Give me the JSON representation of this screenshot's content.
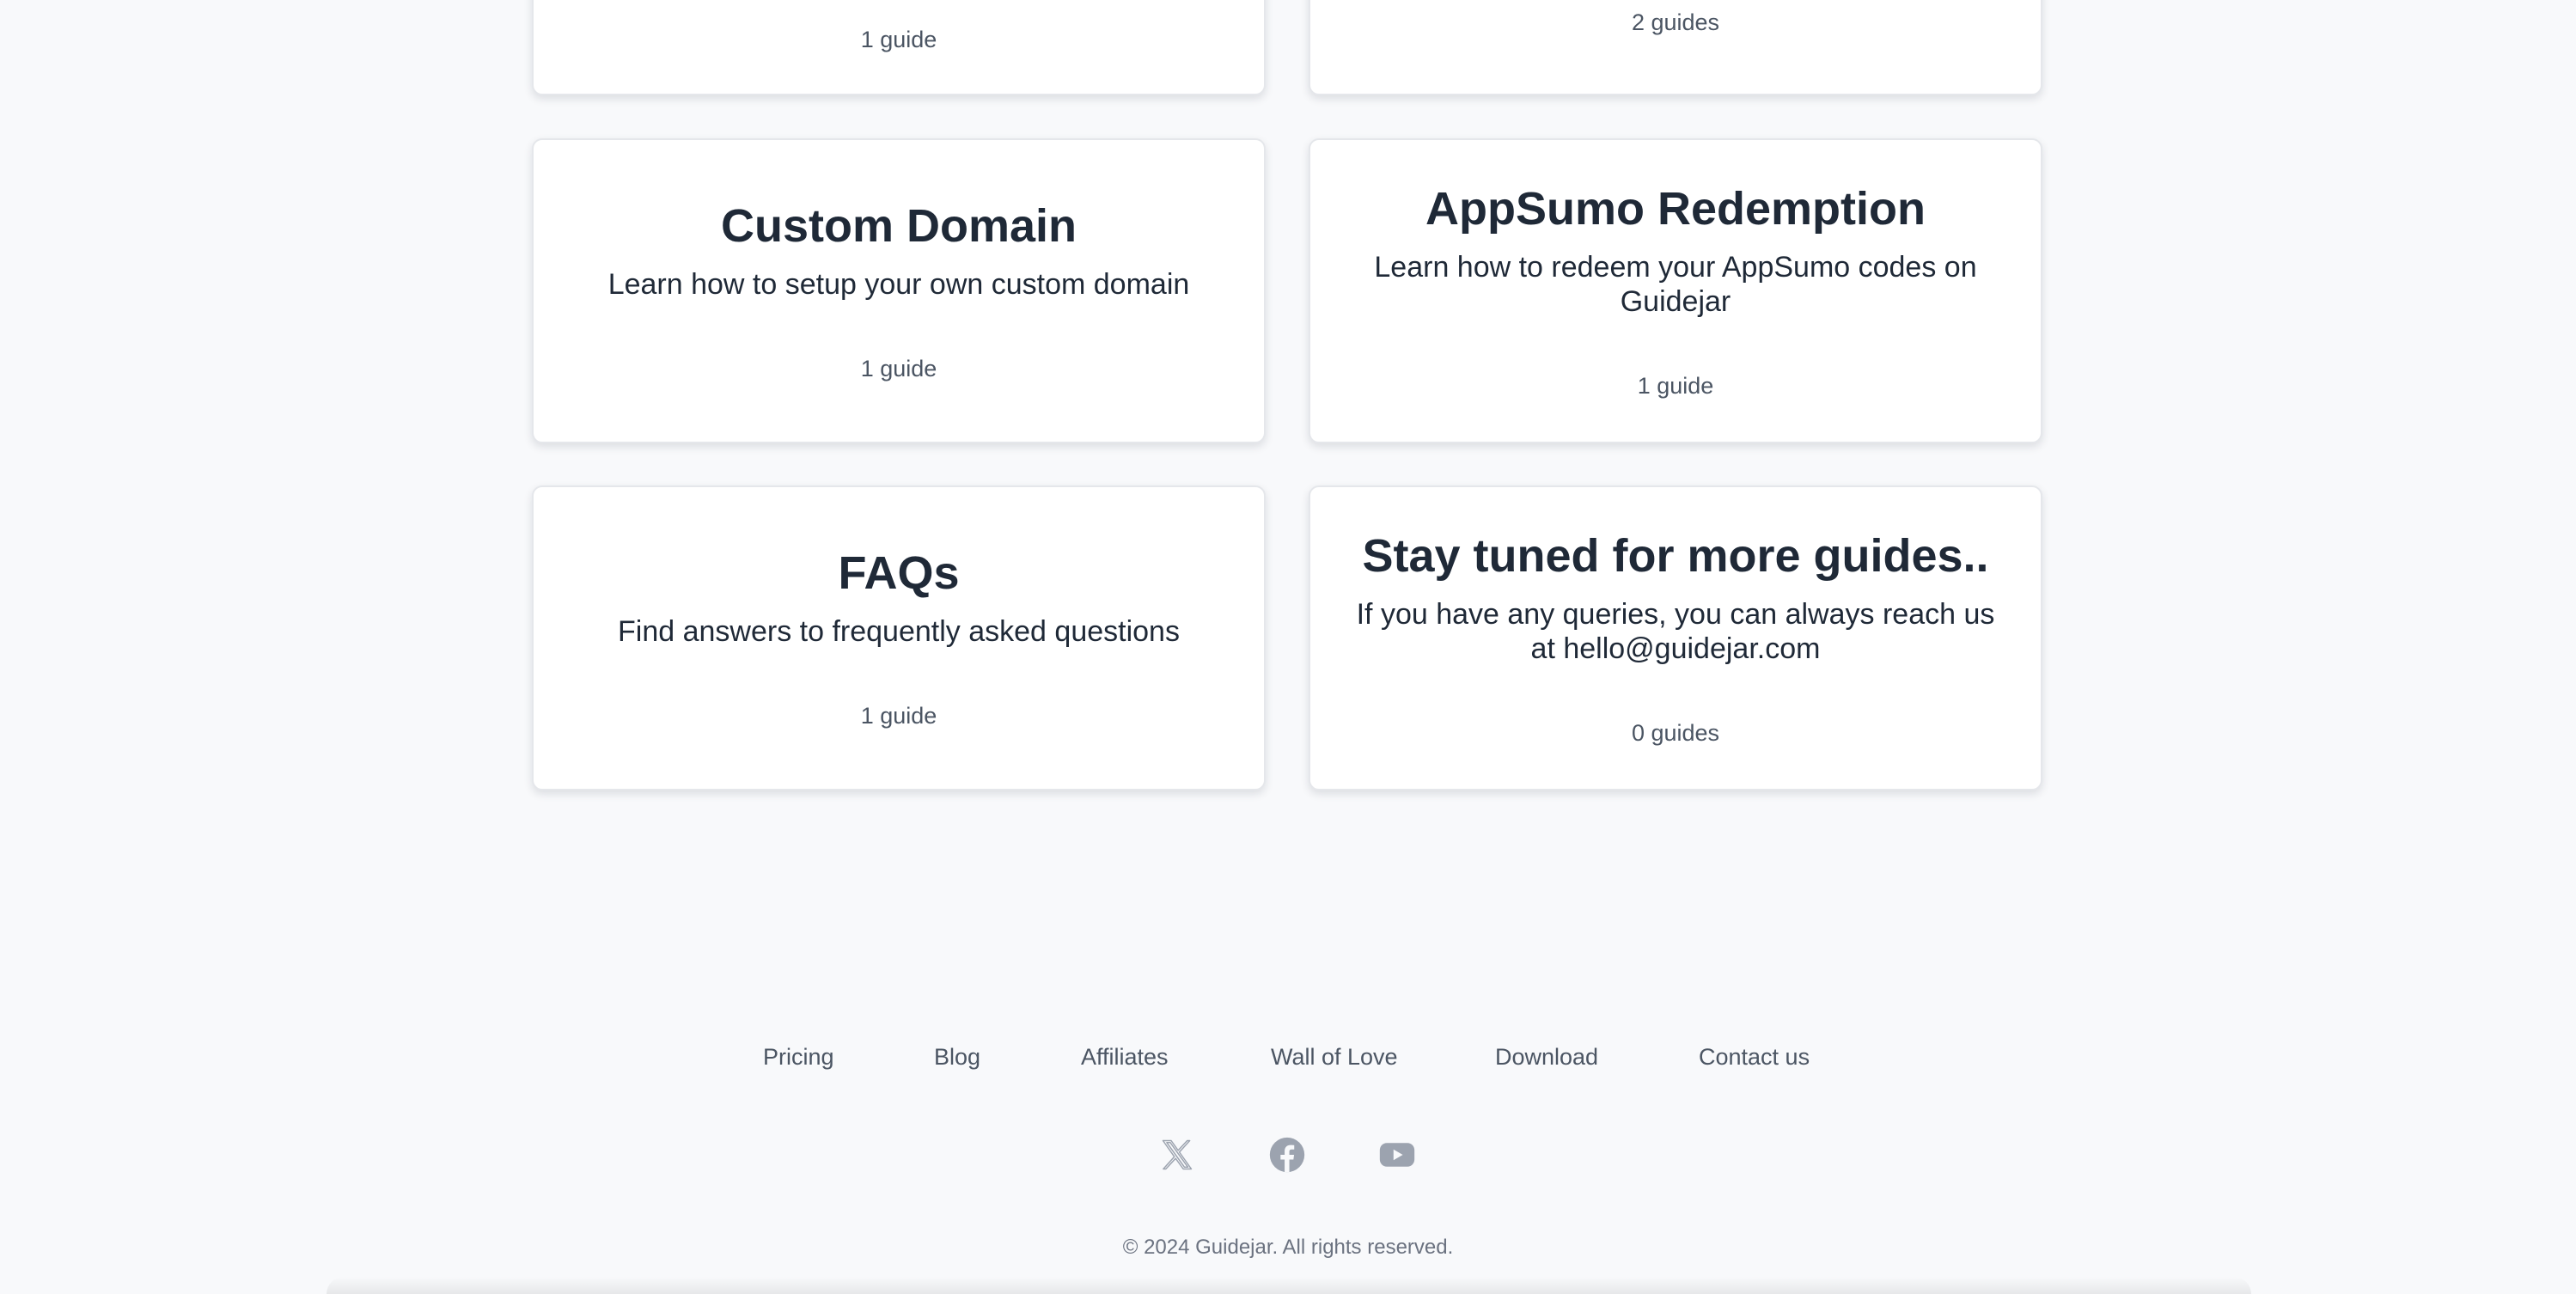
{
  "cards": [
    {
      "title": "",
      "description": "",
      "count": "1 guide"
    },
    {
      "title": "",
      "description": "",
      "count": "2 guides"
    },
    {
      "title": "Custom Domain",
      "description": "Learn how to setup your own custom domain",
      "count": "1 guide"
    },
    {
      "title": "AppSumo Redemption",
      "description": "Learn how to redeem your AppSumo codes on Guidejar",
      "count": "1 guide"
    },
    {
      "title": "FAQs",
      "description": "Find answers to frequently asked questions",
      "count": "1 guide"
    },
    {
      "title": "Stay tuned for more guides..",
      "description": "If you have any queries, you can always reach us at hello@guidejar.com",
      "count": "0 guides"
    }
  ],
  "footer": {
    "links": [
      "Pricing",
      "Blog",
      "Affiliates",
      "Wall of Love",
      "Download",
      "Contact us"
    ],
    "social": [
      "x-icon",
      "facebook-icon",
      "youtube-icon"
    ],
    "copyright": "© 2024 Guidejar. All rights reserved."
  },
  "colors": {
    "background": "#f8f9fb",
    "card": "#ffffff",
    "heading": "#1f2937",
    "muted": "#4b5563",
    "icon": "#9ca3af"
  }
}
